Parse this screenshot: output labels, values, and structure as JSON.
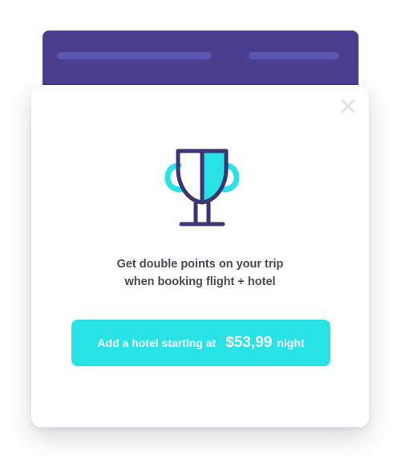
{
  "modal": {
    "message_line1": "Get double points on your trip",
    "message_line2": "when booking flight + hotel",
    "cta_prefix": "Add a hotel starting at",
    "cta_price": "$53,99",
    "cta_suffix": "night",
    "close_icon": "close-icon",
    "trophy_icon": "trophy-icon"
  },
  "colors": {
    "header_purple": "#4a3f8f",
    "accent_cyan": "#27e3e6",
    "icon_navy": "#3b3573"
  }
}
